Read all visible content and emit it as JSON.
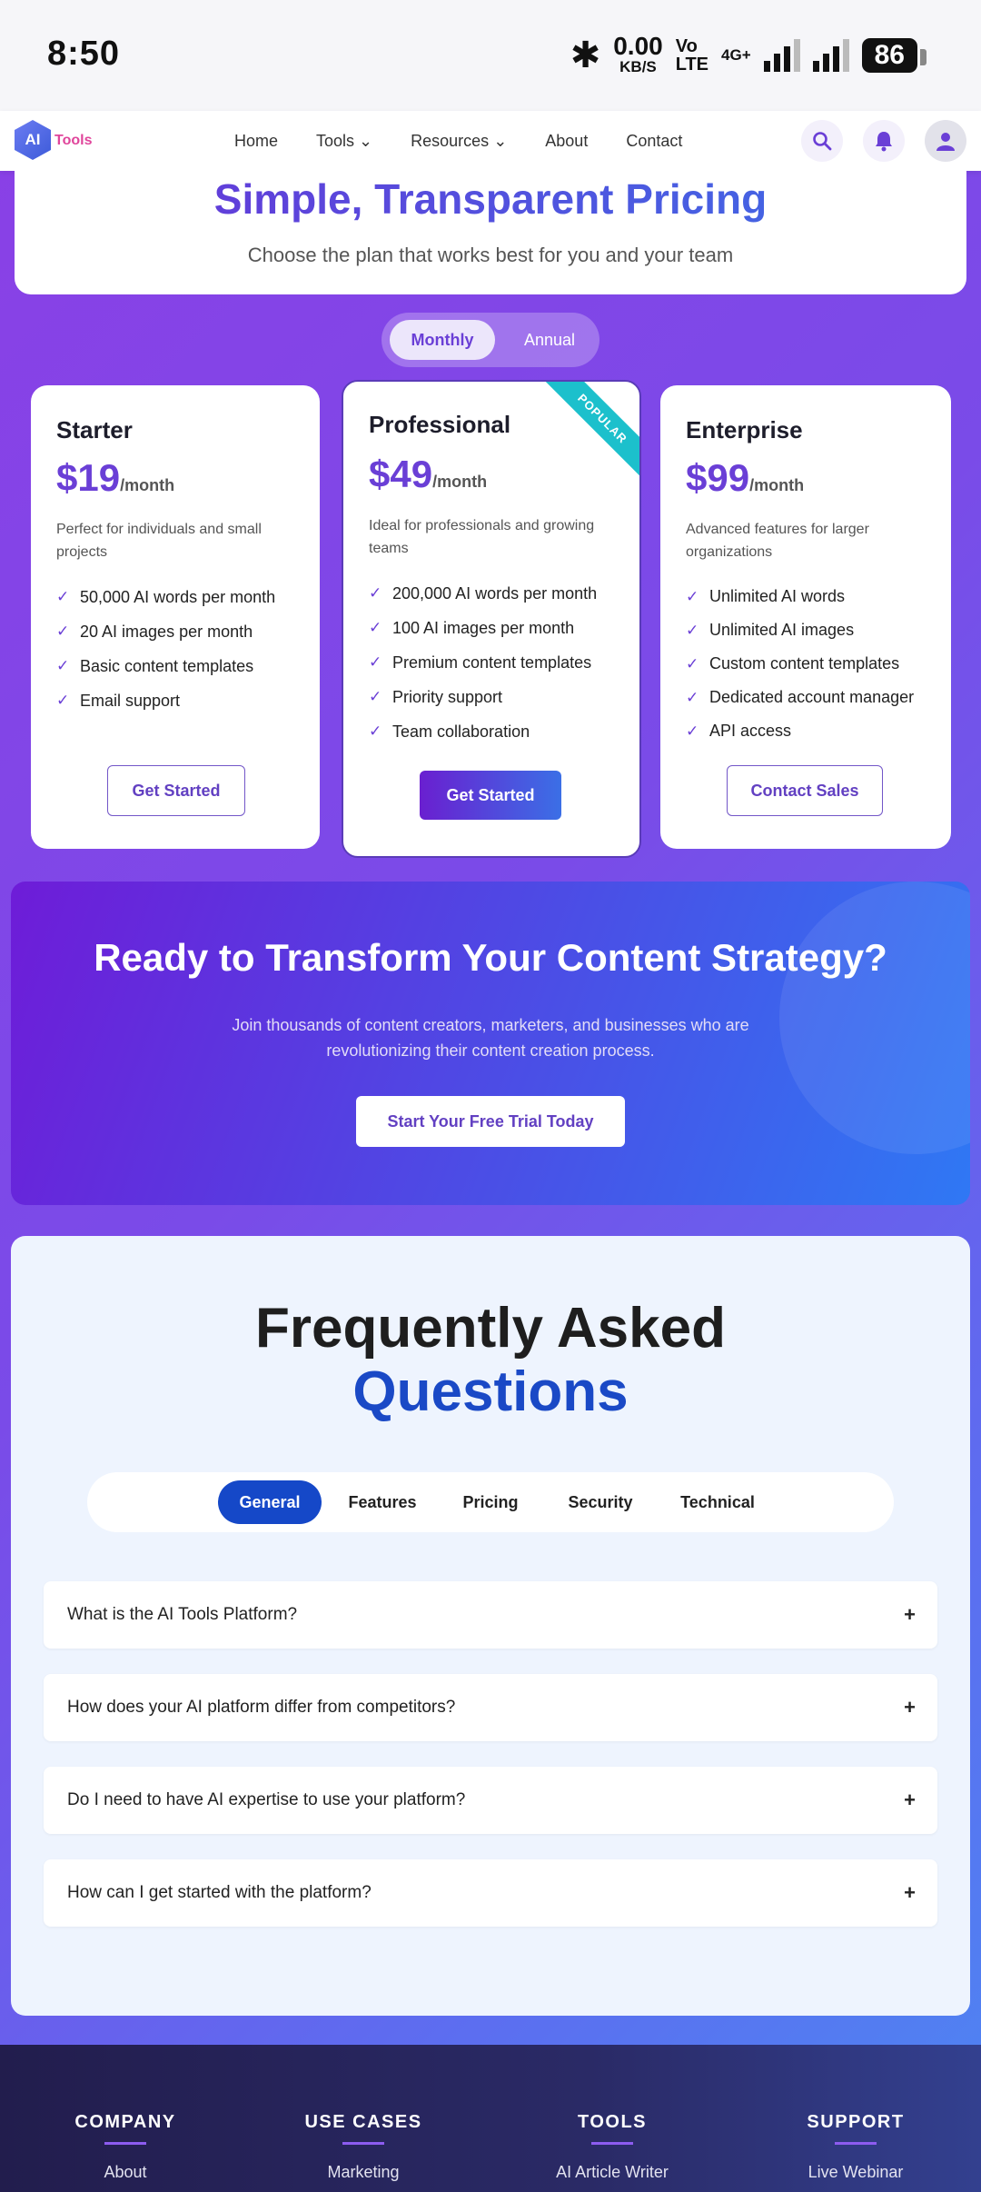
{
  "status_bar": {
    "time": "8:50",
    "speed_value": "0.00",
    "speed_unit": "KB/S",
    "volte_top": "Vo",
    "volte_bottom": "LTE",
    "network": "4G+",
    "battery": "86"
  },
  "nav": {
    "logo_mark": "AI",
    "logo_text": "Tools",
    "links": [
      "Home",
      "Tools",
      "Resources",
      "About",
      "Contact"
    ],
    "icons": [
      "search-icon",
      "bell-icon",
      "user-icon"
    ]
  },
  "hero": {
    "title": "Simple, Transparent Pricing",
    "subtitle": "Choose the plan that works best for you and your team"
  },
  "billing_toggle": {
    "monthly": "Monthly",
    "annual": "Annual",
    "selected": "Monthly"
  },
  "plans": [
    {
      "name": "Starter",
      "price": "$19",
      "period": "/month",
      "description": "Perfect for individuals and small projects",
      "features": [
        "50,000 AI words per month",
        "20 AI images per month",
        "Basic content templates",
        "Email support"
      ],
      "cta": "Get Started"
    },
    {
      "name": "Professional",
      "price": "$49",
      "period": "/month",
      "badge": "POPULAR",
      "description": "Ideal for professionals and growing teams",
      "features": [
        "200,000 AI words per month",
        "100 AI images per month",
        "Premium content templates",
        "Priority support",
        "Team collaboration"
      ],
      "cta": "Get Started"
    },
    {
      "name": "Enterprise",
      "price": "$99",
      "period": "/month",
      "description": "Advanced features for larger organizations",
      "features": [
        "Unlimited AI words",
        "Unlimited AI images",
        "Custom content templates",
        "Dedicated account manager",
        "API access"
      ],
      "cta": "Contact Sales"
    }
  ],
  "cta_section": {
    "title": "Ready to Transform Your Content Strategy?",
    "subtitle": "Join thousands of content creators, marketers, and businesses who are revolutionizing their content creation process.",
    "button": "Start Your Free Trial Today"
  },
  "faq": {
    "title_line1": "Frequently Asked",
    "title_line2": "Questions",
    "tabs": [
      "General",
      "Features",
      "Pricing",
      "Security",
      "Technical"
    ],
    "active_tab": "General",
    "questions": [
      "What is the AI Tools Platform?",
      "How does your AI platform differ from competitors?",
      "Do I need to have AI expertise to use your platform?",
      "How can I get started with the platform?"
    ],
    "expand_symbol": "+"
  },
  "footer": {
    "columns": [
      {
        "heading": "COMPANY",
        "first_link": "About"
      },
      {
        "heading": "USE CASES",
        "first_link": "Marketing"
      },
      {
        "heading": "TOOLS",
        "first_link": "AI Article Writer"
      },
      {
        "heading": "SUPPORT",
        "first_link": "Live Webinar"
      }
    ]
  },
  "colors": {
    "accent": "#6a3fd6",
    "faq_blue": "#1548c8",
    "ribbon": "#1cc0cc"
  }
}
